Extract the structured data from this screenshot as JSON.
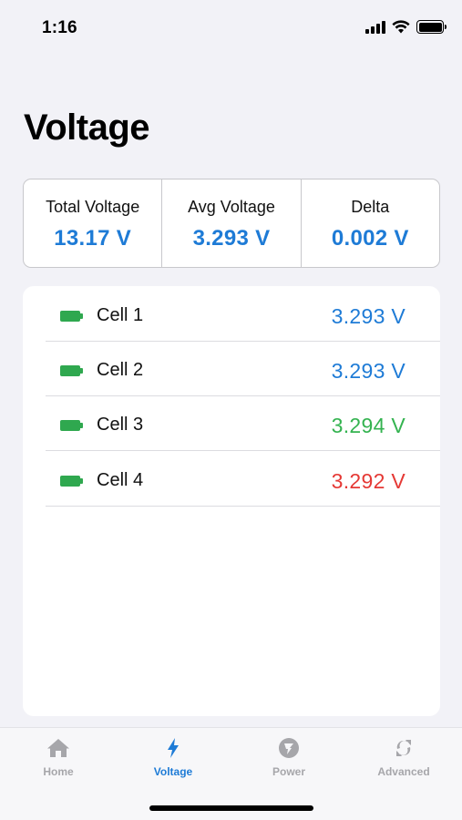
{
  "status_bar": {
    "time": "1:16"
  },
  "page": {
    "title": "Voltage"
  },
  "summary": [
    {
      "label": "Total Voltage",
      "value": "13.17 V"
    },
    {
      "label": "Avg Voltage",
      "value": "3.293 V"
    },
    {
      "label": "Delta",
      "value": "0.002 V"
    }
  ],
  "cells": [
    {
      "name": "Cell 1",
      "value": "3.293 V",
      "color": "#1e7bd6"
    },
    {
      "name": "Cell 2",
      "value": "3.293 V",
      "color": "#1e7bd6"
    },
    {
      "name": "Cell 3",
      "value": "3.294 V",
      "color": "#34b350"
    },
    {
      "name": "Cell 4",
      "value": "3.292 V",
      "color": "#e53935"
    }
  ],
  "tabs": [
    {
      "label": "Home",
      "icon": "house-icon"
    },
    {
      "label": "Voltage",
      "icon": "bolt-icon",
      "active": true
    },
    {
      "label": "Power",
      "icon": "power-plug-icon"
    },
    {
      "label": "Advanced",
      "icon": "refresh-icon"
    }
  ],
  "colors": {
    "accent": "#1e7bd6",
    "inactive": "#a6a6aa",
    "battery": "#2fa84f"
  }
}
